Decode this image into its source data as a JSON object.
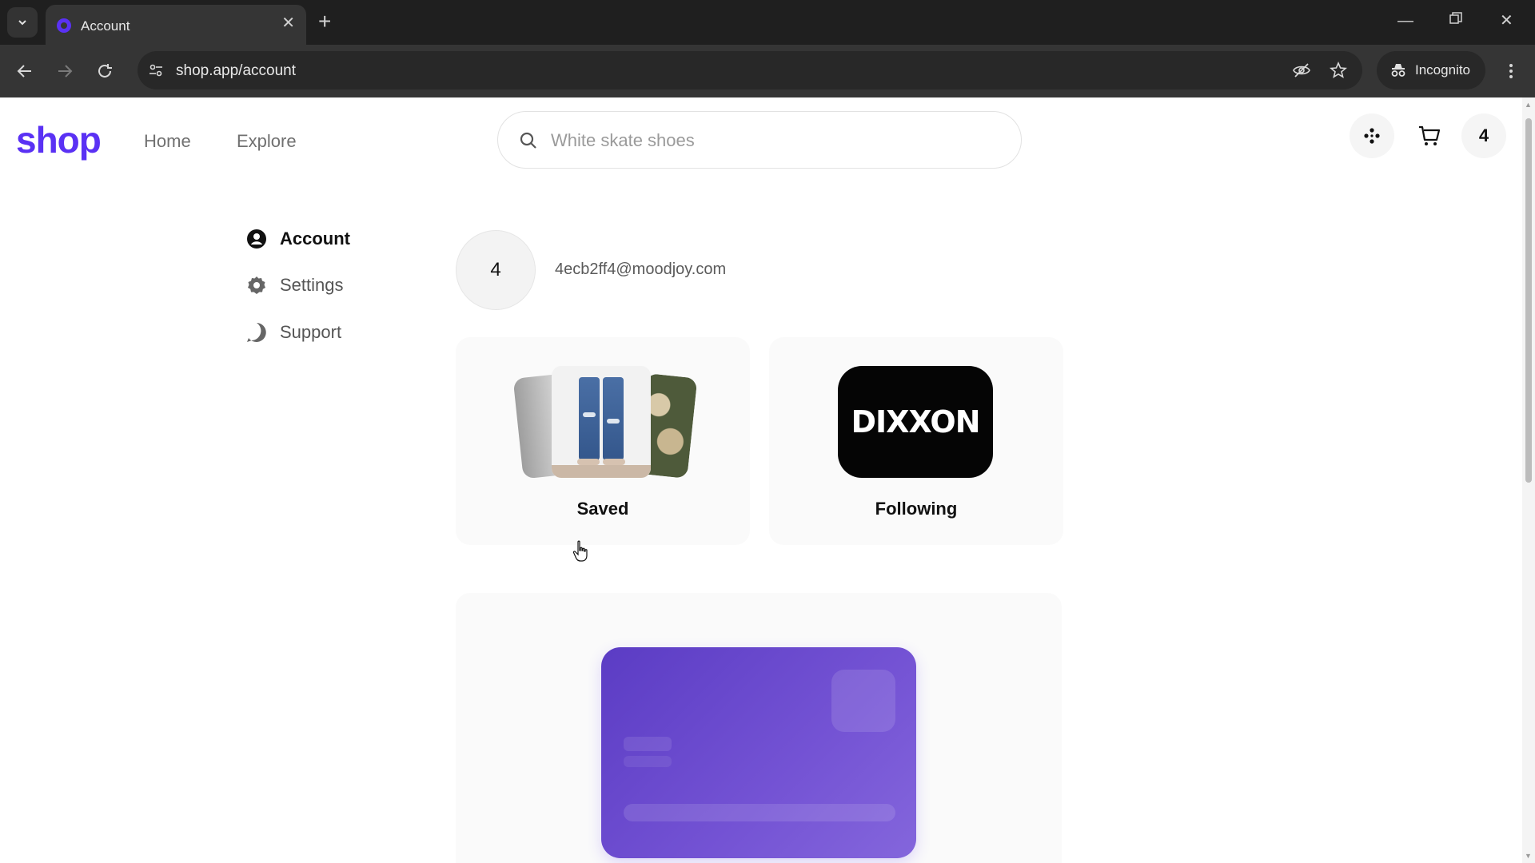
{
  "browser": {
    "tab_title": "Account",
    "url": "shop.app/account",
    "incognito_label": "Incognito"
  },
  "header": {
    "logo": "shop",
    "nav": [
      {
        "label": "Home"
      },
      {
        "label": "Explore"
      }
    ],
    "search_placeholder": "White skate shoes",
    "avatar_initial": "4"
  },
  "sidebar": {
    "items": [
      {
        "label": "Account",
        "icon": "user-circle-icon",
        "active": true
      },
      {
        "label": "Settings",
        "icon": "gear-icon",
        "active": false
      },
      {
        "label": "Support",
        "icon": "help-circle-icon",
        "active": false
      }
    ]
  },
  "profile": {
    "initial": "4",
    "email": "4ecb2ff4@moodjoy.com"
  },
  "cards": {
    "saved": {
      "label": "Saved"
    },
    "following": {
      "label": "Following",
      "brand": "DIXXON"
    }
  },
  "colors": {
    "brand": "#5a31f4",
    "card_purple": "#7453d4"
  }
}
